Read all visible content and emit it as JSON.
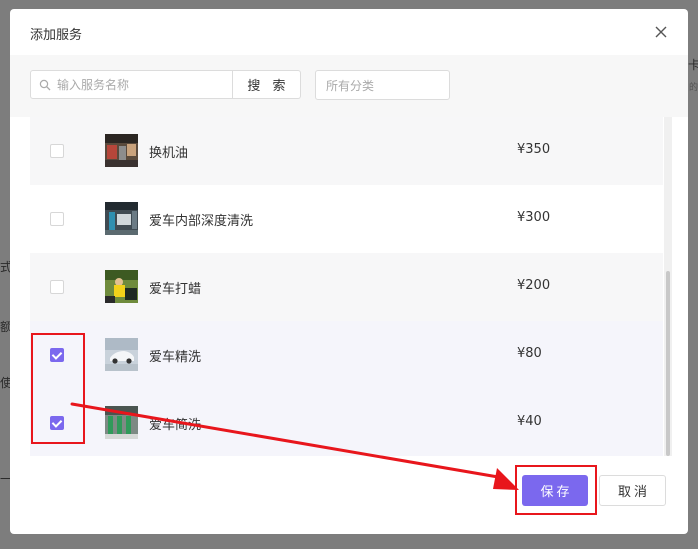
{
  "dialog": {
    "title": "添加服务",
    "search_placeholder": "输入服务名称",
    "search_value": "",
    "search_button_label": "搜 索",
    "category_placeholder": "所有分类",
    "save_label": "保存",
    "cancel_label": "取消"
  },
  "services": [
    {
      "name": "换机油",
      "price": "¥350",
      "checked": false,
      "thumb": "garage-photo"
    },
    {
      "name": "爱车内部深度清洗",
      "price": "¥300",
      "checked": false,
      "thumb": "car-wash-bay-photo"
    },
    {
      "name": "爱车打蜡",
      "price": "¥200",
      "checked": false,
      "thumb": "waxing-worker-photo"
    },
    {
      "name": "爱车精洗",
      "price": "¥80",
      "checked": true,
      "thumb": "white-car-photo"
    },
    {
      "name": "爱车简洗",
      "price": "¥40",
      "checked": true,
      "thumb": "wash-station-photo"
    }
  ],
  "background_fragments": [
    "卡",
    "的",
    "式",
    "额",
    "使",
    "一支"
  ],
  "colors": {
    "accent": "#7b68ee",
    "annotation": "#e8161c",
    "backdrop": "#7d7d7d"
  }
}
